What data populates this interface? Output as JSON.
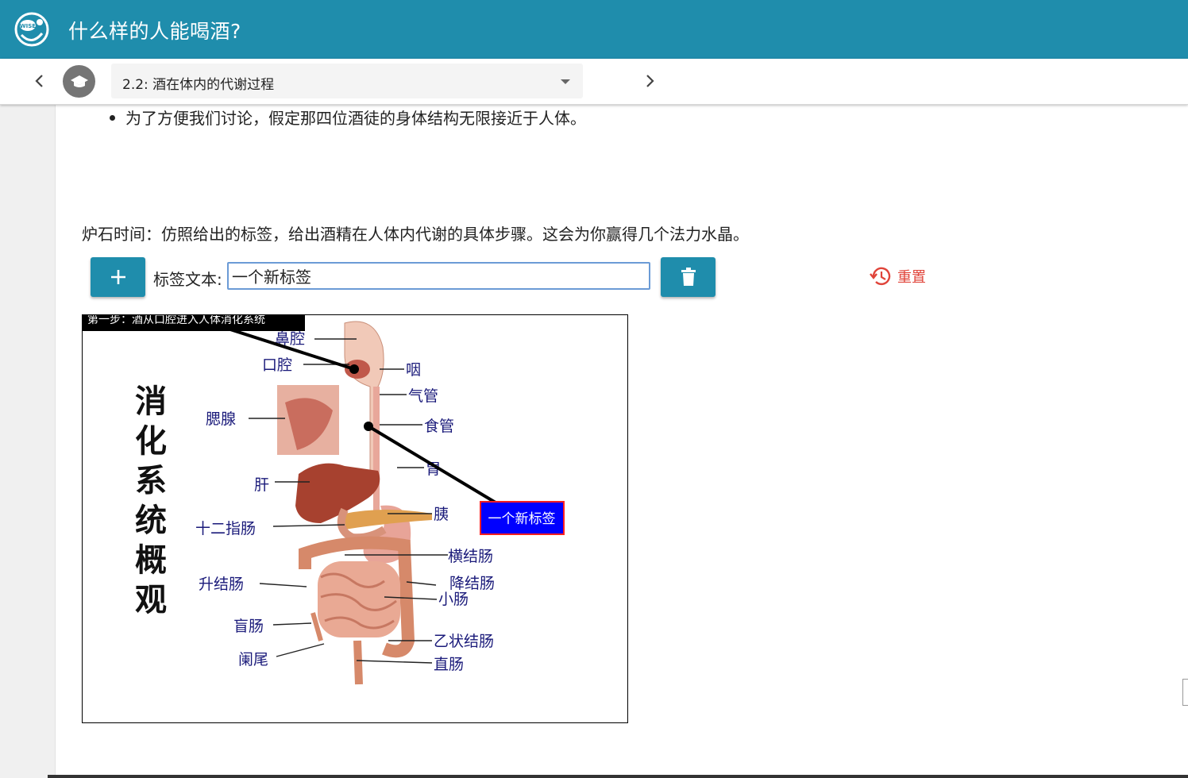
{
  "app": {
    "title": "什么样的人能喝酒?",
    "logo_text": "WISE",
    "logo_icon": "wise-logo-icon"
  },
  "nav": {
    "prev_icon": "chevron-left-icon",
    "next_icon": "chevron-right-icon",
    "step_icon": "graduation-cap-icon",
    "step_label": "2.2: 酒在体内的代谢过程"
  },
  "content": {
    "bullet_text": "为了方便我们讨论，假定那四位酒徒的身体结构无限接近于人体。",
    "prompt_text": "炉石时间：仿照给出的标签，给出酒精在人体内代谢的具体步骤。这会为你赢得几个法力水晶。"
  },
  "toolbar": {
    "add_icon": "plus-icon",
    "label_caption": "标签文本:",
    "label_value": "一个新标签",
    "delete_icon": "trash-icon",
    "reset_icon": "history-icon",
    "reset_label": "重置",
    "accent_color": "#1f8dac",
    "reset_color": "#e0443a"
  },
  "diagram": {
    "banner_text": "第一步：酒从口腔进入人体消化系统",
    "vertical_title": [
      "消",
      "化",
      "系",
      "统",
      "概",
      "观"
    ],
    "organ_labels_left": [
      "鼻腔",
      "口腔",
      "腮腺",
      "肝",
      "十二指肠",
      "升结肠",
      "盲肠",
      "阑尾"
    ],
    "organ_labels_right": [
      "咽",
      "气管",
      "食管",
      "胃",
      "胰",
      "横结肠",
      "降结肠",
      "小肠",
      "乙状结肠",
      "直肠"
    ],
    "user_label": "一个新标签",
    "user_label_bg": "#0000ff",
    "user_label_border": "#ff2020"
  }
}
